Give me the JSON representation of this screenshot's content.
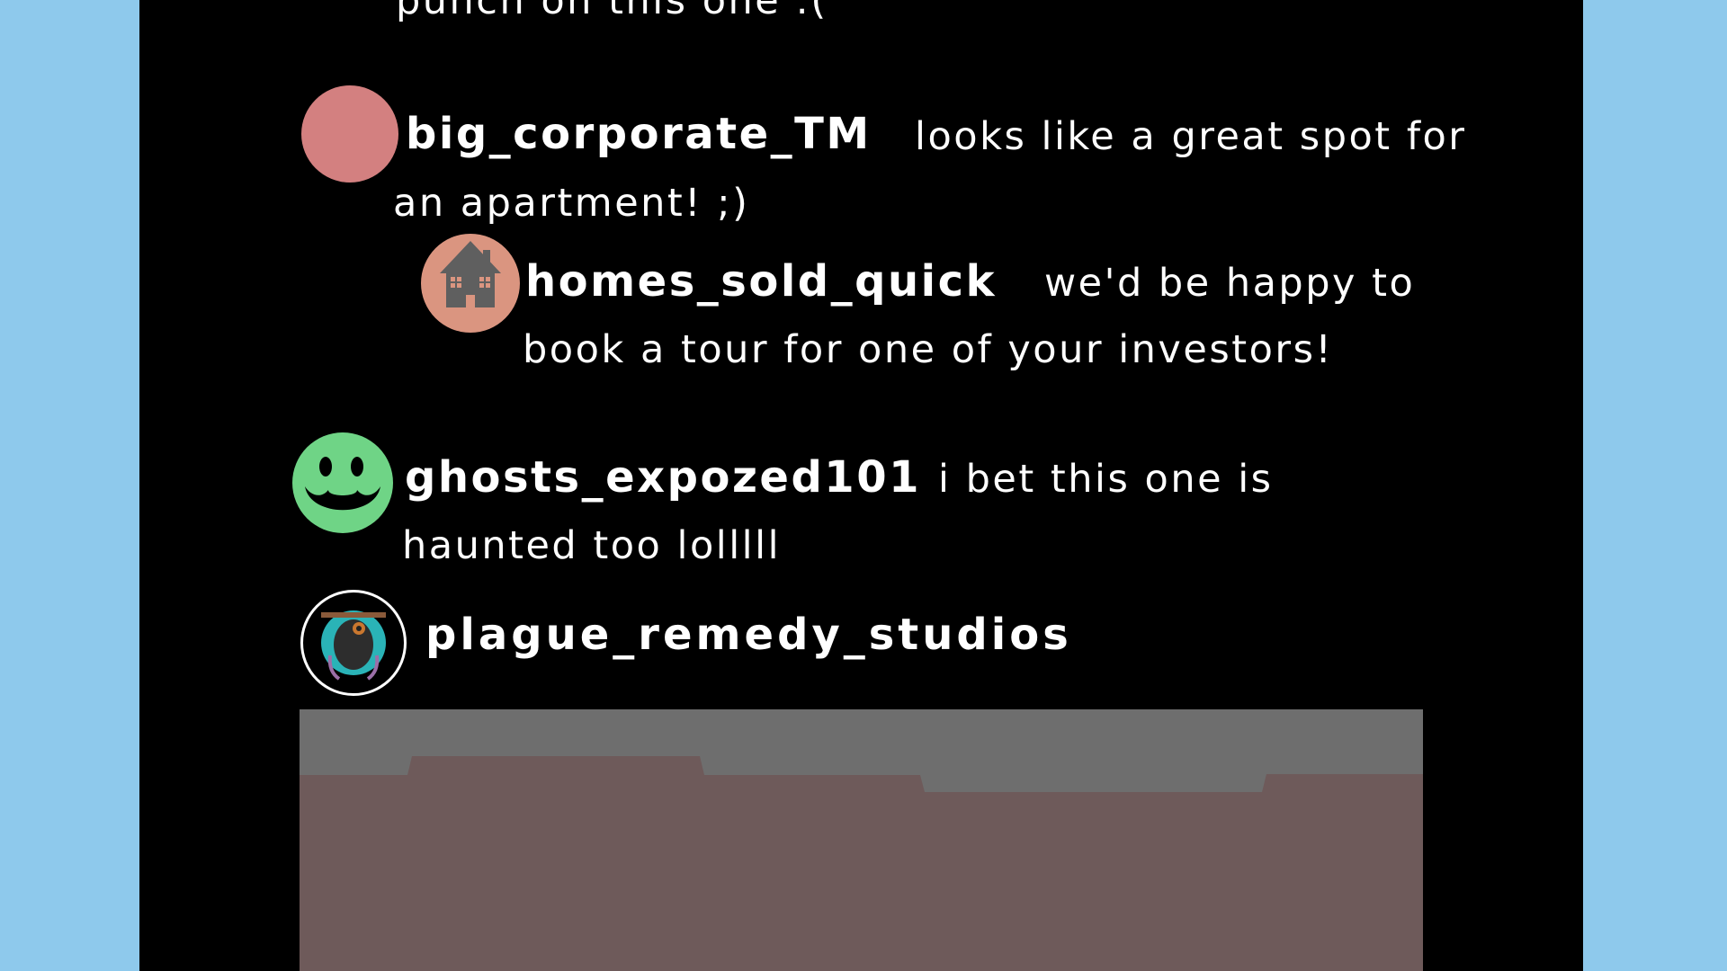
{
  "colors": {
    "background": "#8ec9ec",
    "panel": "#000000",
    "text": "#ffffff",
    "avatar_corporate": "#d38080",
    "avatar_homes": "#da9580",
    "avatar_ghosts": "#6fd486",
    "image_sky": "#6e6e6e",
    "image_ground": "#6e5a5a"
  },
  "comments": [
    {
      "text_prev": "punch on this one :("
    },
    {
      "username": "big_corporate_TM",
      "avatar_icon": "pink-circle-avatar",
      "line1": "looks like a great spot for",
      "line2": "an apartment! ;)"
    },
    {
      "username": "homes_sold_quick",
      "avatar_icon": "house-icon",
      "line1": "we'd be happy to",
      "line2": "book a tour for one of your investors!"
    },
    {
      "username": "ghosts_expozed101",
      "avatar_icon": "smiley-face-icon",
      "line1": "i bet this one is",
      "line2": "haunted too lolllll"
    },
    {
      "username": "plague_remedy_studios",
      "avatar_icon": "plague-doctor-avatar"
    }
  ]
}
